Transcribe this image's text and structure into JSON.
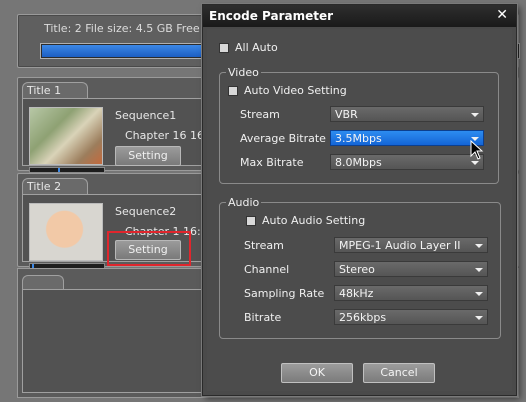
{
  "app": {
    "info_line": "Title: 2   File size: 4.5 GB   Free",
    "progress_fraction": 0.96,
    "titles": [
      {
        "tab": "Title 1",
        "sequence": "Sequence1",
        "chapter": "Chapter 16    16:",
        "setting": "Setting"
      },
      {
        "tab": "Title 2",
        "sequence": "Sequence2",
        "chapter": "Chapter 1    16:",
        "setting": "Setting"
      }
    ]
  },
  "dialog": {
    "title": "Encode Parameter",
    "close_icon": "close-icon",
    "all_auto": {
      "label": "All Auto",
      "checked": false
    },
    "video": {
      "group_label": "Video",
      "auto_setting": {
        "label": "Auto Video Setting",
        "checked": false
      },
      "fields": [
        {
          "label": "Stream",
          "value": "VBR"
        },
        {
          "label": "Average Bitrate",
          "value": "3.5Mbps"
        },
        {
          "label": "Max Bitrate",
          "value": "8.0Mbps"
        }
      ]
    },
    "audio": {
      "group_label": "Audio",
      "auto_setting": {
        "label": "Auto Audio Setting",
        "checked": false
      },
      "fields": [
        {
          "label": "Stream",
          "value": "MPEG-1 Audio Layer II"
        },
        {
          "label": "Channel",
          "value": "Stereo"
        },
        {
          "label": "Sampling Rate",
          "value": "48kHz"
        },
        {
          "label": "Bitrate",
          "value": "256kbps"
        }
      ]
    },
    "ok_label": "OK",
    "cancel_label": "Cancel"
  },
  "colors": {
    "accent": "#1e74e0",
    "highlight_box": "#e0262d"
  }
}
